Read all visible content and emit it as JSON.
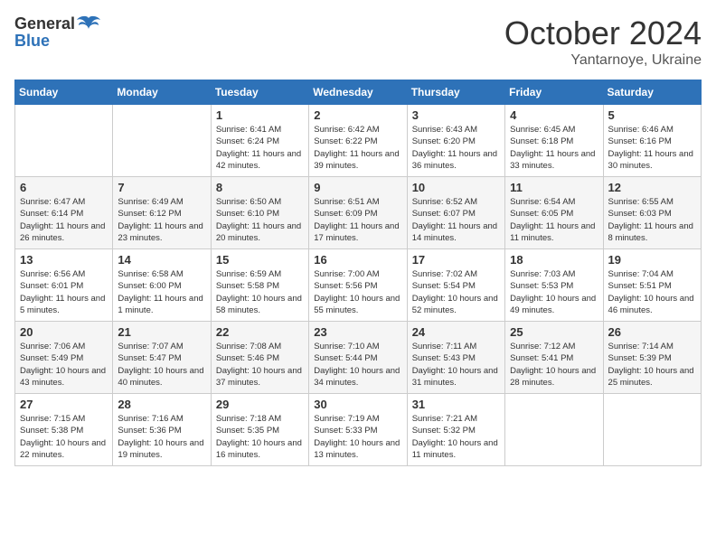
{
  "header": {
    "logo_general": "General",
    "logo_blue": "Blue",
    "month": "October 2024",
    "location": "Yantarnoye, Ukraine"
  },
  "days_of_week": [
    "Sunday",
    "Monday",
    "Tuesday",
    "Wednesday",
    "Thursday",
    "Friday",
    "Saturday"
  ],
  "weeks": [
    [
      {
        "day": "",
        "sunrise": "",
        "sunset": "",
        "daylight": ""
      },
      {
        "day": "",
        "sunrise": "",
        "sunset": "",
        "daylight": ""
      },
      {
        "day": "1",
        "sunrise": "Sunrise: 6:41 AM",
        "sunset": "Sunset: 6:24 PM",
        "daylight": "Daylight: 11 hours and 42 minutes."
      },
      {
        "day": "2",
        "sunrise": "Sunrise: 6:42 AM",
        "sunset": "Sunset: 6:22 PM",
        "daylight": "Daylight: 11 hours and 39 minutes."
      },
      {
        "day": "3",
        "sunrise": "Sunrise: 6:43 AM",
        "sunset": "Sunset: 6:20 PM",
        "daylight": "Daylight: 11 hours and 36 minutes."
      },
      {
        "day": "4",
        "sunrise": "Sunrise: 6:45 AM",
        "sunset": "Sunset: 6:18 PM",
        "daylight": "Daylight: 11 hours and 33 minutes."
      },
      {
        "day": "5",
        "sunrise": "Sunrise: 6:46 AM",
        "sunset": "Sunset: 6:16 PM",
        "daylight": "Daylight: 11 hours and 30 minutes."
      }
    ],
    [
      {
        "day": "6",
        "sunrise": "Sunrise: 6:47 AM",
        "sunset": "Sunset: 6:14 PM",
        "daylight": "Daylight: 11 hours and 26 minutes."
      },
      {
        "day": "7",
        "sunrise": "Sunrise: 6:49 AM",
        "sunset": "Sunset: 6:12 PM",
        "daylight": "Daylight: 11 hours and 23 minutes."
      },
      {
        "day": "8",
        "sunrise": "Sunrise: 6:50 AM",
        "sunset": "Sunset: 6:10 PM",
        "daylight": "Daylight: 11 hours and 20 minutes."
      },
      {
        "day": "9",
        "sunrise": "Sunrise: 6:51 AM",
        "sunset": "Sunset: 6:09 PM",
        "daylight": "Daylight: 11 hours and 17 minutes."
      },
      {
        "day": "10",
        "sunrise": "Sunrise: 6:52 AM",
        "sunset": "Sunset: 6:07 PM",
        "daylight": "Daylight: 11 hours and 14 minutes."
      },
      {
        "day": "11",
        "sunrise": "Sunrise: 6:54 AM",
        "sunset": "Sunset: 6:05 PM",
        "daylight": "Daylight: 11 hours and 11 minutes."
      },
      {
        "day": "12",
        "sunrise": "Sunrise: 6:55 AM",
        "sunset": "Sunset: 6:03 PM",
        "daylight": "Daylight: 11 hours and 8 minutes."
      }
    ],
    [
      {
        "day": "13",
        "sunrise": "Sunrise: 6:56 AM",
        "sunset": "Sunset: 6:01 PM",
        "daylight": "Daylight: 11 hours and 5 minutes."
      },
      {
        "day": "14",
        "sunrise": "Sunrise: 6:58 AM",
        "sunset": "Sunset: 6:00 PM",
        "daylight": "Daylight: 11 hours and 1 minute."
      },
      {
        "day": "15",
        "sunrise": "Sunrise: 6:59 AM",
        "sunset": "Sunset: 5:58 PM",
        "daylight": "Daylight: 10 hours and 58 minutes."
      },
      {
        "day": "16",
        "sunrise": "Sunrise: 7:00 AM",
        "sunset": "Sunset: 5:56 PM",
        "daylight": "Daylight: 10 hours and 55 minutes."
      },
      {
        "day": "17",
        "sunrise": "Sunrise: 7:02 AM",
        "sunset": "Sunset: 5:54 PM",
        "daylight": "Daylight: 10 hours and 52 minutes."
      },
      {
        "day": "18",
        "sunrise": "Sunrise: 7:03 AM",
        "sunset": "Sunset: 5:53 PM",
        "daylight": "Daylight: 10 hours and 49 minutes."
      },
      {
        "day": "19",
        "sunrise": "Sunrise: 7:04 AM",
        "sunset": "Sunset: 5:51 PM",
        "daylight": "Daylight: 10 hours and 46 minutes."
      }
    ],
    [
      {
        "day": "20",
        "sunrise": "Sunrise: 7:06 AM",
        "sunset": "Sunset: 5:49 PM",
        "daylight": "Daylight: 10 hours and 43 minutes."
      },
      {
        "day": "21",
        "sunrise": "Sunrise: 7:07 AM",
        "sunset": "Sunset: 5:47 PM",
        "daylight": "Daylight: 10 hours and 40 minutes."
      },
      {
        "day": "22",
        "sunrise": "Sunrise: 7:08 AM",
        "sunset": "Sunset: 5:46 PM",
        "daylight": "Daylight: 10 hours and 37 minutes."
      },
      {
        "day": "23",
        "sunrise": "Sunrise: 7:10 AM",
        "sunset": "Sunset: 5:44 PM",
        "daylight": "Daylight: 10 hours and 34 minutes."
      },
      {
        "day": "24",
        "sunrise": "Sunrise: 7:11 AM",
        "sunset": "Sunset: 5:43 PM",
        "daylight": "Daylight: 10 hours and 31 minutes."
      },
      {
        "day": "25",
        "sunrise": "Sunrise: 7:12 AM",
        "sunset": "Sunset: 5:41 PM",
        "daylight": "Daylight: 10 hours and 28 minutes."
      },
      {
        "day": "26",
        "sunrise": "Sunrise: 7:14 AM",
        "sunset": "Sunset: 5:39 PM",
        "daylight": "Daylight: 10 hours and 25 minutes."
      }
    ],
    [
      {
        "day": "27",
        "sunrise": "Sunrise: 7:15 AM",
        "sunset": "Sunset: 5:38 PM",
        "daylight": "Daylight: 10 hours and 22 minutes."
      },
      {
        "day": "28",
        "sunrise": "Sunrise: 7:16 AM",
        "sunset": "Sunset: 5:36 PM",
        "daylight": "Daylight: 10 hours and 19 minutes."
      },
      {
        "day": "29",
        "sunrise": "Sunrise: 7:18 AM",
        "sunset": "Sunset: 5:35 PM",
        "daylight": "Daylight: 10 hours and 16 minutes."
      },
      {
        "day": "30",
        "sunrise": "Sunrise: 7:19 AM",
        "sunset": "Sunset: 5:33 PM",
        "daylight": "Daylight: 10 hours and 13 minutes."
      },
      {
        "day": "31",
        "sunrise": "Sunrise: 7:21 AM",
        "sunset": "Sunset: 5:32 PM",
        "daylight": "Daylight: 10 hours and 11 minutes."
      },
      {
        "day": "",
        "sunrise": "",
        "sunset": "",
        "daylight": ""
      },
      {
        "day": "",
        "sunrise": "",
        "sunset": "",
        "daylight": ""
      }
    ]
  ]
}
